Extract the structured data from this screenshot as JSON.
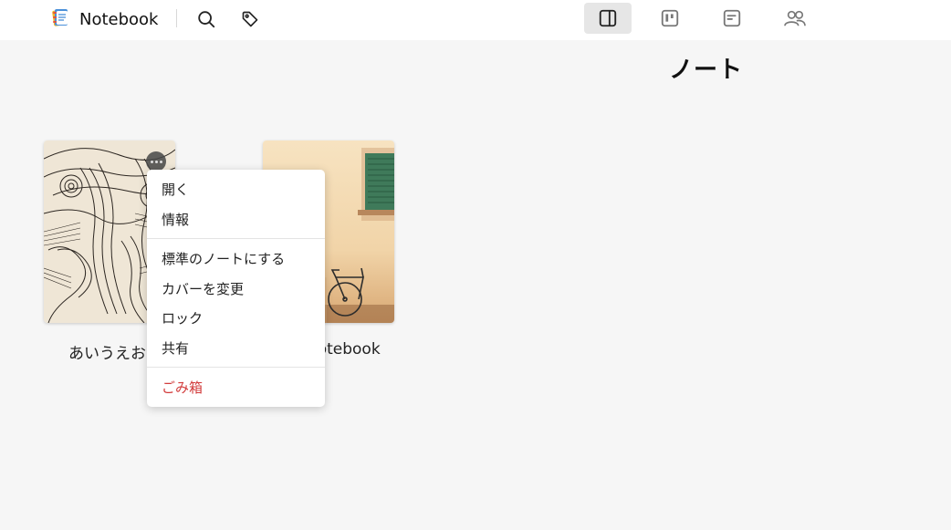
{
  "header": {
    "app_name": "Notebook"
  },
  "page": {
    "title": "ノート"
  },
  "notebooks": [
    {
      "caption": "あいうえお"
    },
    {
      "caption": "Notebook"
    }
  ],
  "context_menu": {
    "items": [
      {
        "label": "開く"
      },
      {
        "label": "情報"
      },
      {
        "label": "標準のノートにする"
      },
      {
        "label": "カバーを変更"
      },
      {
        "label": "ロック"
      },
      {
        "label": "共有"
      },
      {
        "label": "ごみ箱"
      }
    ]
  },
  "colors": {
    "accent_danger": "#d23b3b",
    "background": "#f6f6f6",
    "active_view": "#e6e6e6"
  },
  "icons": {
    "logo": "notebook-logo-icon",
    "search": "search-icon",
    "tag": "tag-icon",
    "views": [
      "sidebar-view-icon",
      "board-view-icon",
      "note-view-icon",
      "users-icon"
    ]
  }
}
